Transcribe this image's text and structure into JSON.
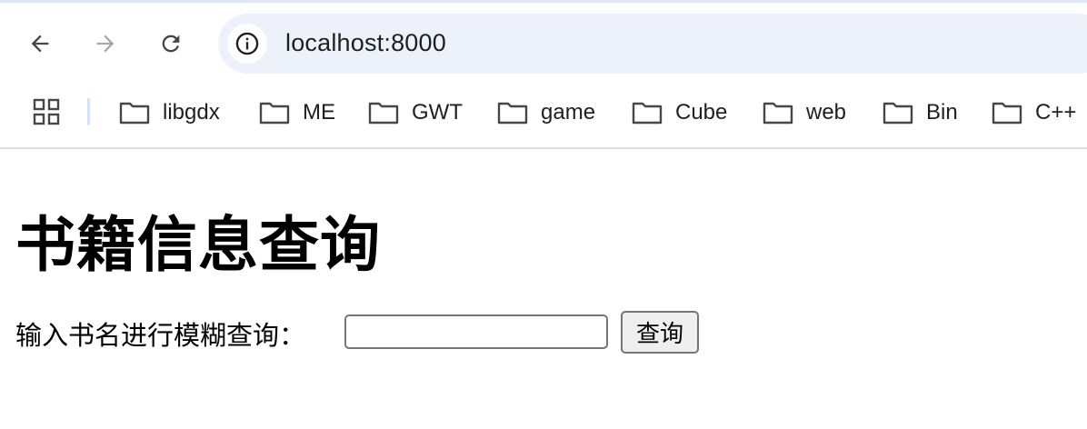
{
  "browser": {
    "url": "localhost:8000",
    "back_icon": "back-arrow-icon",
    "forward_icon": "forward-arrow-icon",
    "reload_icon": "reload-icon",
    "info_icon": "info-icon"
  },
  "bookmarks": {
    "apps_icon": "apps-grid-icon",
    "items": [
      {
        "label": "libgdx"
      },
      {
        "label": "ME"
      },
      {
        "label": "GWT"
      },
      {
        "label": "game"
      },
      {
        "label": "Cube"
      },
      {
        "label": "web"
      },
      {
        "label": "Bin"
      },
      {
        "label": "C++"
      }
    ]
  },
  "page": {
    "title": "书籍信息查询",
    "search_label": "输入书名进行模糊查询：",
    "search_value": "",
    "search_button": "查询"
  }
}
